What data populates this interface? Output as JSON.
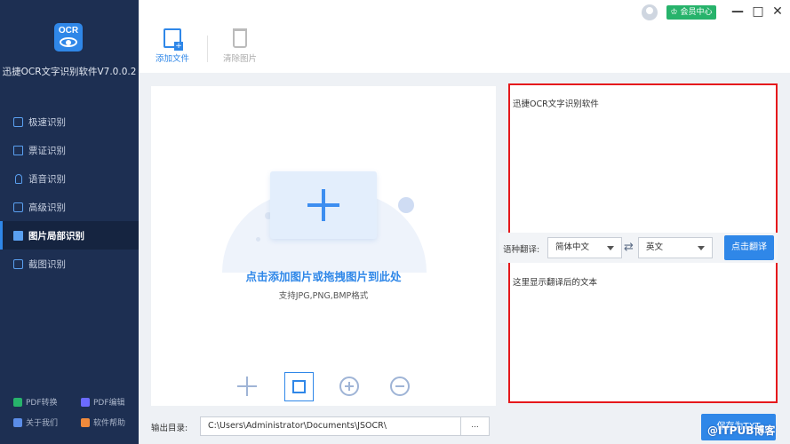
{
  "app": {
    "title": "迅捷OCR文字识别软件V7.0.0.2",
    "logo_text": "OCR"
  },
  "sidebar": {
    "items": [
      {
        "label": "极速识别",
        "icon": "speed-icon"
      },
      {
        "label": "票证识别",
        "icon": "ticket-icon"
      },
      {
        "label": "语音识别",
        "icon": "microphone-icon"
      },
      {
        "label": "高级识别",
        "icon": "advanced-icon"
      },
      {
        "label": "图片局部识别",
        "icon": "image-icon",
        "active": true
      },
      {
        "label": "截图识别",
        "icon": "screenshot-icon"
      }
    ],
    "footer": [
      {
        "label": "PDF转换",
        "color": "#27b36b"
      },
      {
        "label": "PDF编辑",
        "color": "#6b6bff"
      },
      {
        "label": "关于我们",
        "color": "#5b8de8"
      },
      {
        "label": "软件帮助",
        "color": "#f08a3c"
      }
    ]
  },
  "topbar": {
    "member_label": "会员中心",
    "minimize": "—",
    "maximize": "□",
    "close": "✕"
  },
  "toolbar": {
    "add_label": "添加文件",
    "clear_label": "清除图片"
  },
  "upload": {
    "title": "点击添加图片或拖拽图片到此处",
    "subtitle": "支持JPG,PNG,BMP格式"
  },
  "result": {
    "ocr_text": "迅捷OCR文字识别软件",
    "translate_label": "语种翻译:",
    "source_lang": "简体中文",
    "target_lang": "英文",
    "swap_symbol": "⇄",
    "translate_button": "点击翻译",
    "translation_placeholder": "这里显示翻译后的文本"
  },
  "output": {
    "label": "输出目录:",
    "path": "C:\\Users\\Administrator\\Documents\\JSOCR\\",
    "browse": "...",
    "save_button": "保存为TXT"
  },
  "watermark": "@ITPUB博客",
  "colors": {
    "sidebar": "#1d2f52",
    "accent": "#2f87e8",
    "highlight_border": "#e5191c",
    "member": "#27b36b"
  }
}
